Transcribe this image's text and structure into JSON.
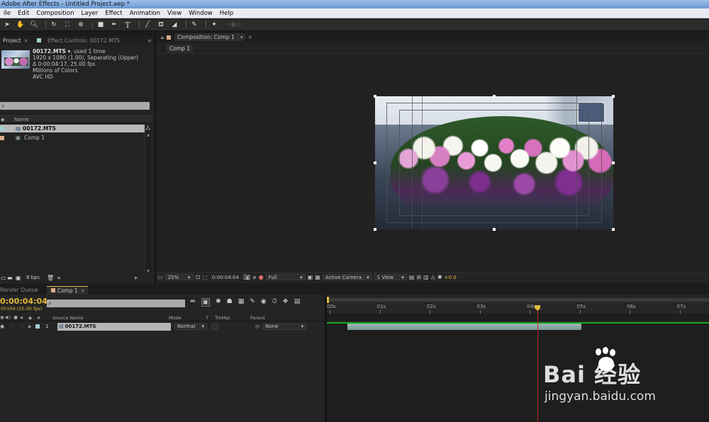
{
  "window": {
    "title": "Adobe After Effects - Untitled Project.aep *"
  },
  "menu": [
    "ile",
    "Edit",
    "Composition",
    "Layer",
    "Effect",
    "Animation",
    "View",
    "Window",
    "Help"
  ],
  "toolbar": {
    "icons": [
      "selection-tool-icon",
      "hand-tool-icon",
      "zoom-tool-icon",
      "rotate-tool-icon",
      "camera-tool-icon",
      "pan-behind-tool-icon",
      "rectangle-tool-icon",
      "pen-tool-icon",
      "type-tool-icon",
      "brush-tool-icon",
      "clone-stamp-tool-icon",
      "eraser-tool-icon",
      "roto-brush-tool-icon",
      "puppet-pin-tool-icon"
    ],
    "type_glyph": "T"
  },
  "project": {
    "tab_project": "Project",
    "tab_effect_controls": "Effect Controls: 00172.MTS",
    "footage": {
      "name": "00172.MTS ▾",
      "used": ", used 1 time",
      "resolution": "1920 x 1080 (1.00), Separating (Upper)",
      "duration": "Δ 0:00:04:17, 25.00 fps",
      "colors": "Millions of Colors",
      "codec": "AVC HD"
    },
    "search_glyph": "⌕",
    "column_name": "Name",
    "items": [
      {
        "name": "00172.MTS",
        "selected": true
      },
      {
        "name": "Comp 1",
        "selected": false
      }
    ],
    "bpc": "8 bpc"
  },
  "viewer": {
    "tab": "Composition: Comp 1",
    "breadcrumb": "Comp 1",
    "zoom": "25%",
    "timecode": "0:00:04:04",
    "resolution": "Full",
    "camera": "Active Camera",
    "views": "1 View",
    "exposure": "+0.0"
  },
  "timeline": {
    "tab_render": "Render Queue",
    "tab_comp": "Comp 1",
    "current_time": "0:00:04:04",
    "frame_info": "00104 (25.00 fps)",
    "search_glyph": "⌕",
    "headers": {
      "num": "#",
      "source": "Source Name",
      "mode": "Mode",
      "t": "T",
      "trkmat": "TrkMat",
      "parent": "Parent"
    },
    "layer": {
      "index": "1",
      "name": "00172.MTS",
      "mode": "Normal",
      "parent": "None"
    },
    "ruler": [
      "00s",
      "01s",
      "02s",
      "03s",
      "04s",
      "05s",
      "06s",
      "07s"
    ],
    "playhead_seconds": 4.16,
    "layer_duration_seconds": 4.68,
    "layer_in_seconds": 0.0
  },
  "watermark": {
    "brand": "Bai 经验",
    "url": "jingyan.baidu.com"
  }
}
